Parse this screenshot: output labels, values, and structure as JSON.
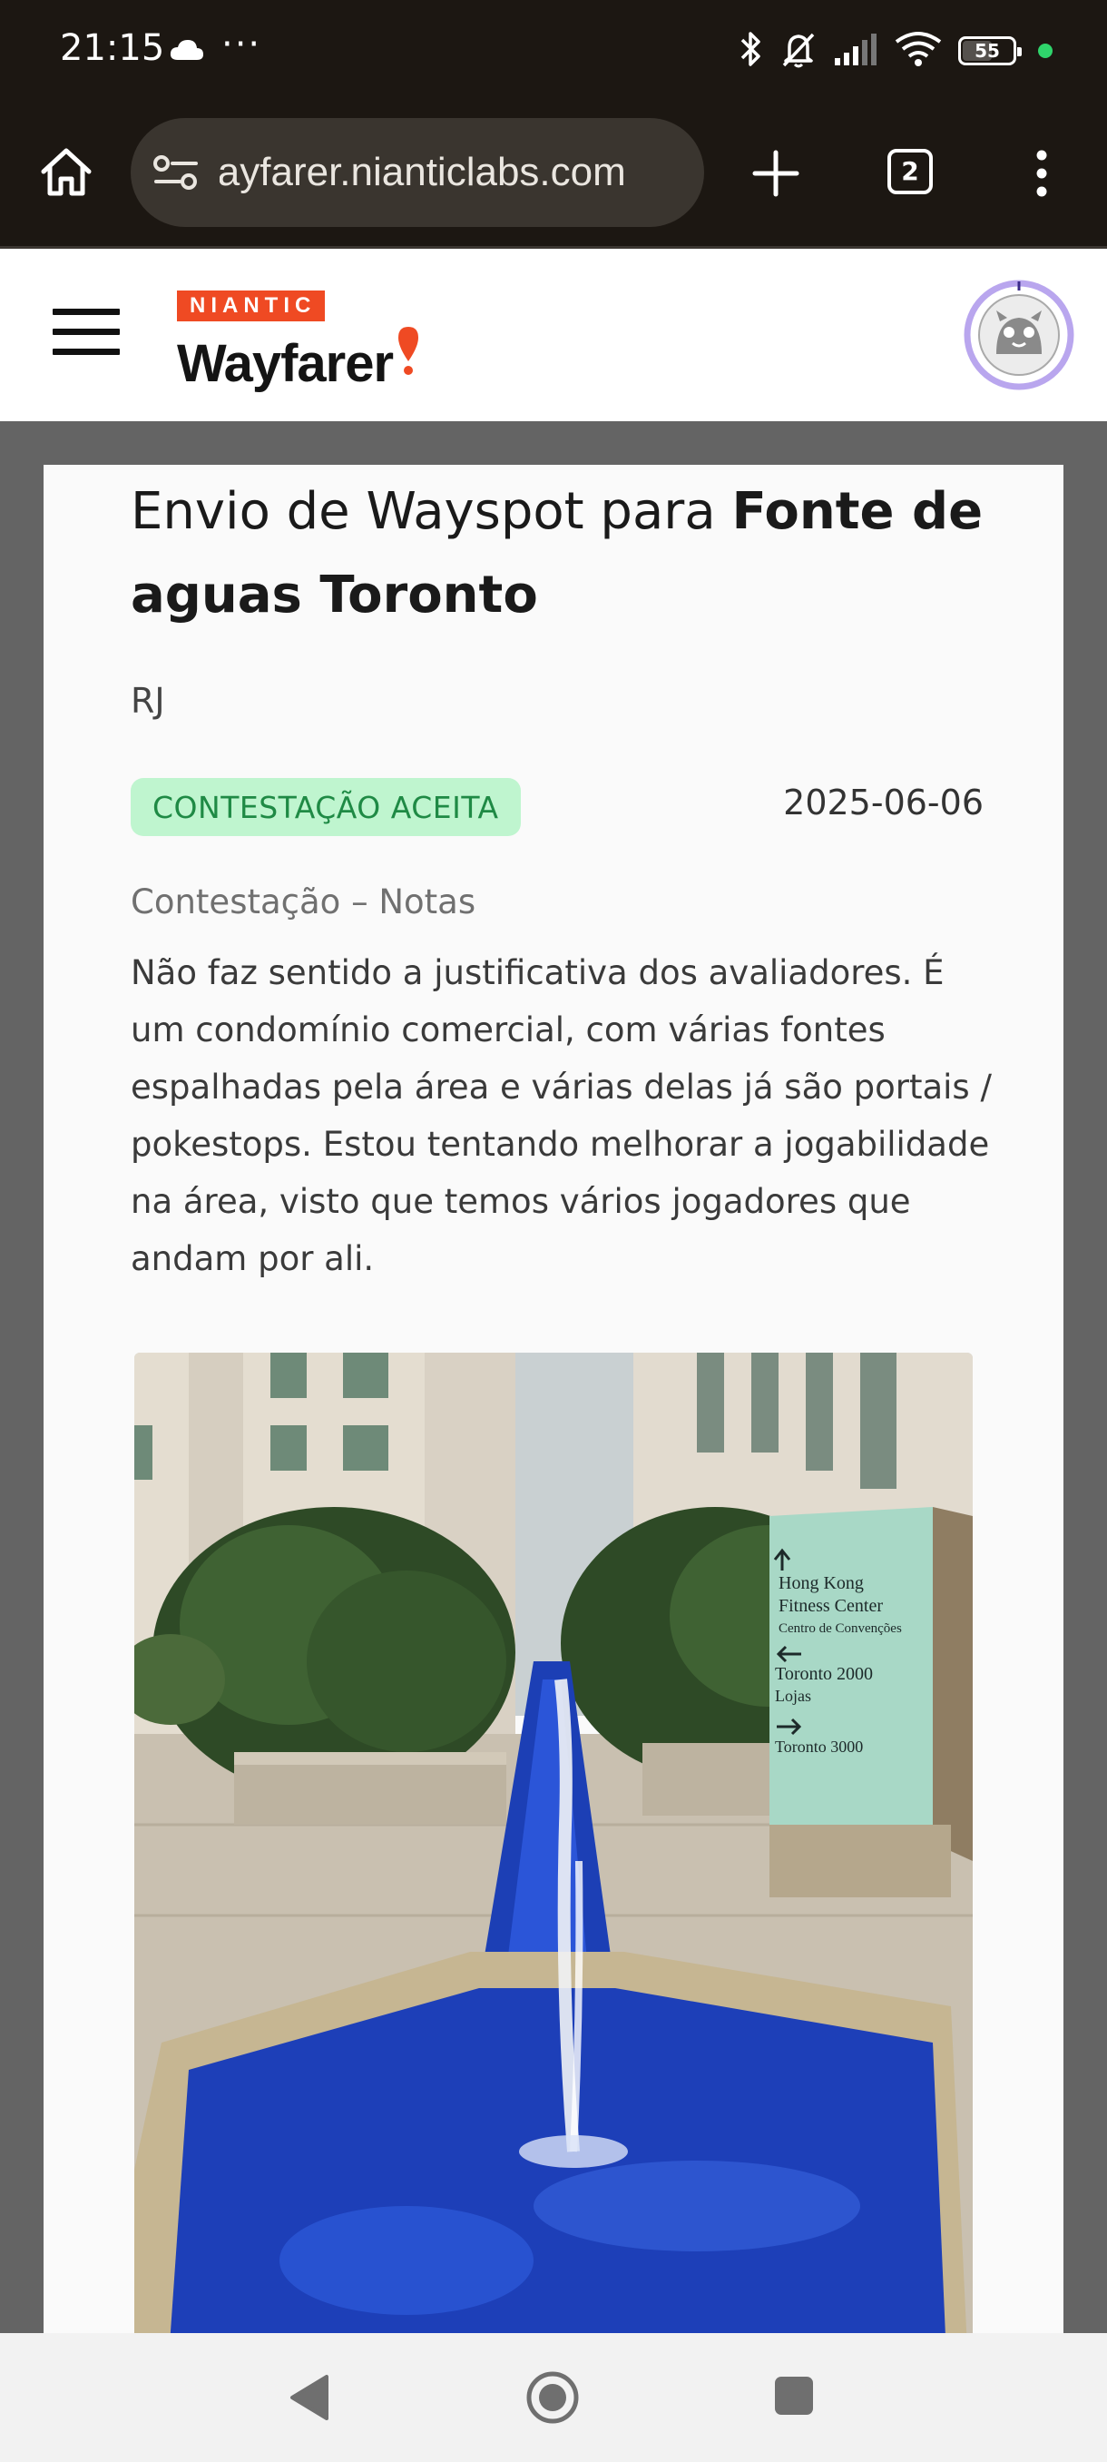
{
  "status_bar": {
    "time": "21:15",
    "dots": "···",
    "battery_level": "55",
    "icons": [
      "cloud-icon",
      "bluetooth-icon",
      "mute-bell-icon",
      "signal-icon",
      "wifi-icon",
      "battery-icon"
    ],
    "indicator_color": "#2fd46b"
  },
  "browser": {
    "url": "wayfarer.nianticlabs.com",
    "tab_count": "2",
    "icons": [
      "home-icon",
      "site-settings-icon",
      "plus-icon",
      "tabs-icon",
      "more-vert-icon"
    ]
  },
  "header": {
    "brand_small": "NIANTIC",
    "brand_name": "Wayfarer",
    "accent_color": "#ef4a23",
    "icons": [
      "hamburger-menu-icon",
      "map-pin-icon",
      "user-avatar"
    ]
  },
  "submission": {
    "title_prefix": "Envio de Wayspot para ",
    "title_name": "Fonte de aguas Toronto",
    "location": "RJ",
    "status": "CONTESTAÇÃO ACEITA",
    "status_color": "#1f8a45",
    "date": "2025-06-06",
    "notes_label": "Contestação – Notas",
    "notes_text": "Não faz sentido a justificativa dos avaliadores. É um condomínio comercial, com várias fontes espalhadas pela área e várias delas já são portais / pokestops. Estou tentando melhorar a jogabilidade na área, visto que temos vários jogadores que andam por ali.",
    "photo": {
      "sign_lines": [
        "Hong Kong",
        "Fitness Center",
        "Centro de Convenções",
        "Toronto 2000",
        "Lojas",
        "Toronto 3000"
      ]
    }
  },
  "nav_bar": {
    "icons": [
      "back-icon",
      "home-circle-icon",
      "recents-icon"
    ]
  }
}
